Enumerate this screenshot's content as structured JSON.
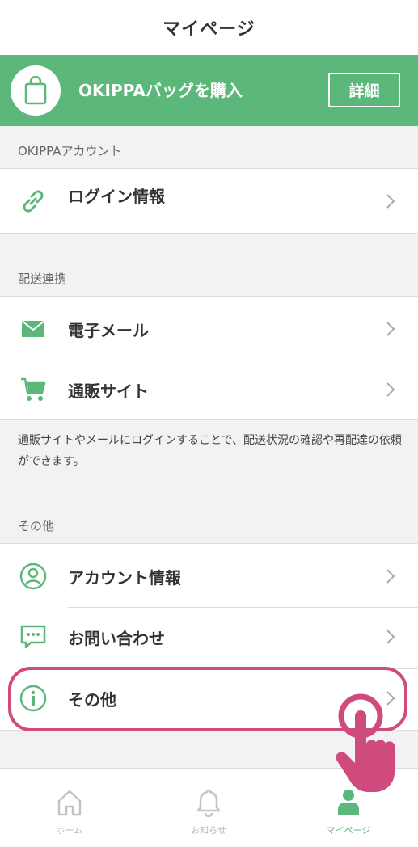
{
  "header": {
    "title": "マイページ"
  },
  "banner": {
    "text": "OKIPPAバッグを購入",
    "button_label": "詳細",
    "icon": "shopping-bag-icon"
  },
  "sections": {
    "account": {
      "label": "OKIPPAアカウント",
      "items": [
        {
          "label": "ログイン情報",
          "icon": "link-icon"
        }
      ]
    },
    "delivery": {
      "label": "配送連携",
      "items": [
        {
          "label": "電子メール",
          "icon": "mail-icon"
        },
        {
          "label": "通販サイト",
          "icon": "cart-icon"
        }
      ],
      "note": "通販サイトやメールにログインすることで、配送状況の確認や再配達の依頼ができます。"
    },
    "other": {
      "label": "その他",
      "items": [
        {
          "label": "アカウント情報",
          "icon": "user-circle-icon"
        },
        {
          "label": "お問い合わせ",
          "icon": "chat-bubble-icon"
        },
        {
          "label": "その他",
          "icon": "info-icon"
        }
      ]
    }
  },
  "tabbar": {
    "tabs": [
      {
        "label": "ホーム",
        "icon": "home-icon"
      },
      {
        "label": "お知らせ",
        "icon": "bell-icon"
      },
      {
        "label": "マイページ",
        "icon": "person-icon",
        "active": true
      }
    ]
  },
  "colors": {
    "accent": "#5cb87a",
    "highlight": "#cf4b7e",
    "background": "#f2f2f2",
    "inactive_tab": "#b8b8b8"
  }
}
